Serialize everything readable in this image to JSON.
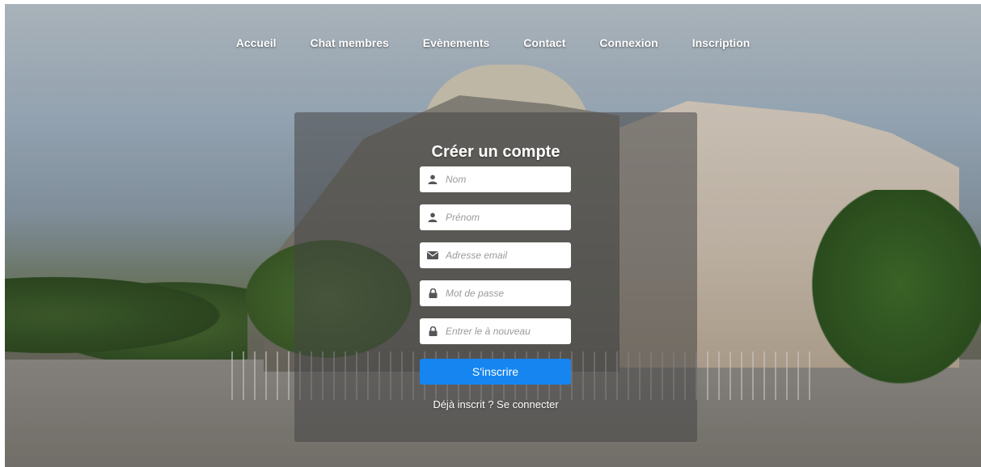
{
  "nav": {
    "items": [
      {
        "label": "Accueil"
      },
      {
        "label": "Chat membres"
      },
      {
        "label": "Evènements"
      },
      {
        "label": "Contact"
      },
      {
        "label": "Connexion"
      },
      {
        "label": "Inscription"
      }
    ]
  },
  "form": {
    "title": "Créer un compte",
    "fields": [
      {
        "placeholder": "Nom",
        "icon": "user-icon",
        "value": ""
      },
      {
        "placeholder": "Prénom",
        "icon": "user-icon",
        "value": ""
      },
      {
        "placeholder": "Adresse email",
        "icon": "envelope-icon",
        "value": ""
      },
      {
        "placeholder": "Mot de passe",
        "icon": "lock-icon",
        "value": ""
      },
      {
        "placeholder": "Entrer le à nouveau",
        "icon": "lock-icon",
        "value": ""
      }
    ],
    "submit_label": "S'inscrire",
    "login_link": "Déjà inscrit ? Se connecter"
  },
  "colors": {
    "accent": "#1685f0",
    "panel": "#464646",
    "icon": "#555555"
  }
}
